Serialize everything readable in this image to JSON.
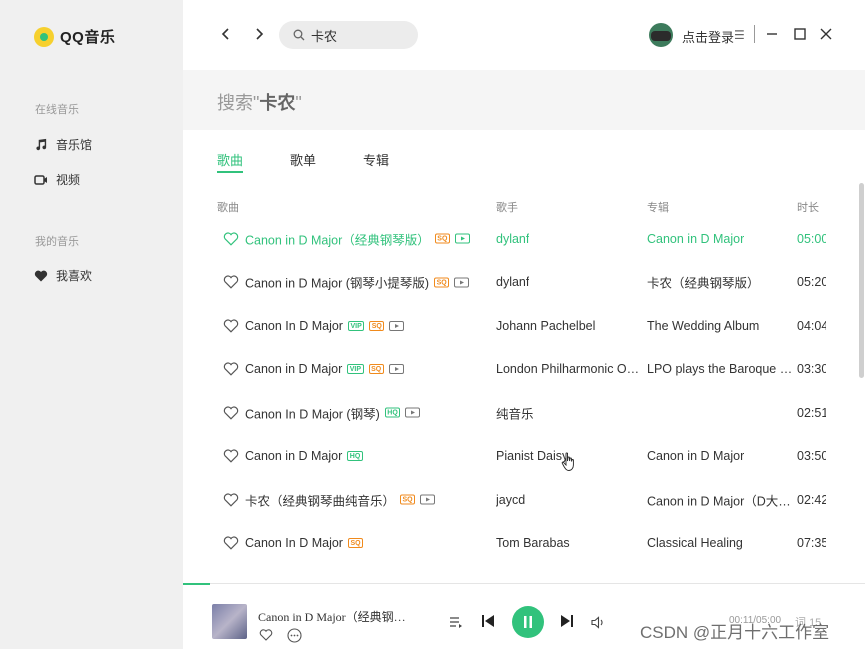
{
  "app": {
    "name": "QQ音乐"
  },
  "sidebar": {
    "online_section": "在线音乐",
    "my_section": "我的音乐",
    "items": [
      {
        "label": "音乐馆",
        "icon": "music-note-icon"
      },
      {
        "label": "视频",
        "icon": "video-icon"
      },
      {
        "label": "我喜欢",
        "icon": "heart-icon"
      }
    ]
  },
  "header": {
    "search_value": "卡农",
    "login_label": "点击登录",
    "menu_glyph": "☰"
  },
  "search_band": {
    "prefix": "搜索\"",
    "keyword": "卡农",
    "suffix": "\""
  },
  "tabs": [
    {
      "label": "歌曲",
      "active": true
    },
    {
      "label": "歌单",
      "active": false
    },
    {
      "label": "专辑",
      "active": false
    }
  ],
  "table": {
    "columns": {
      "song": "歌曲",
      "artist": "歌手",
      "album": "专辑",
      "duration": "时长"
    },
    "rows": [
      {
        "title": "Canon in D Major（经典钢琴版）",
        "badges": [
          "sq",
          "mv"
        ],
        "artist": "dylanf",
        "album": "Canon in D Major",
        "duration": "05:00",
        "playing": true
      },
      {
        "title": "Canon in D Major (钢琴小提琴版)",
        "badges": [
          "sq",
          "mv"
        ],
        "artist": "dylanf",
        "album": "卡农（经典钢琴版）",
        "duration": "05:20",
        "playing": false
      },
      {
        "title": "Canon In D Major",
        "badges": [
          "vip",
          "sq",
          "mv"
        ],
        "artist": "Johann Pachelbel",
        "album": "The Wedding Album",
        "duration": "04:04",
        "playing": false
      },
      {
        "title": "Canon in D Major",
        "badges": [
          "vip",
          "sq",
          "mv"
        ],
        "artist": "London Philharmonic O…",
        "album": "LPO plays the Baroque …",
        "duration": "03:30",
        "playing": false
      },
      {
        "title": "Canon In D Major (钢琴)",
        "badges": [
          "hq",
          "mv"
        ],
        "artist": "纯音乐",
        "album": "",
        "duration": "02:51",
        "playing": false
      },
      {
        "title": "Canon in D Major",
        "badges": [
          "hq"
        ],
        "artist": "Pianist Daisy",
        "album": "Canon in D Major",
        "duration": "03:50",
        "playing": false
      },
      {
        "title": "卡农（经典钢琴曲纯音乐）",
        "badges": [
          "sq",
          "mv"
        ],
        "artist": "jaycd",
        "album": "Canon in D Major（D大…",
        "duration": "02:42",
        "playing": false
      },
      {
        "title": "Canon In D Major",
        "badges": [
          "sq"
        ],
        "artist": "Tom Barabas",
        "album": "Classical Healing",
        "duration": "07:35",
        "playing": false
      }
    ]
  },
  "badge_labels": {
    "vip": "VIP",
    "sq": "SQ",
    "hq": "HQ"
  },
  "player": {
    "now_playing": "Canon in D Major（经典钢…",
    "time": "00:11/05:00",
    "extra": "词",
    "count": "15",
    "progress": 0.04
  },
  "watermark": "CSDN @正月十六工作室",
  "colors": {
    "accent": "#31c27c",
    "sq": "#f08a1c",
    "sidebar_bg": "#f0f0f0"
  }
}
